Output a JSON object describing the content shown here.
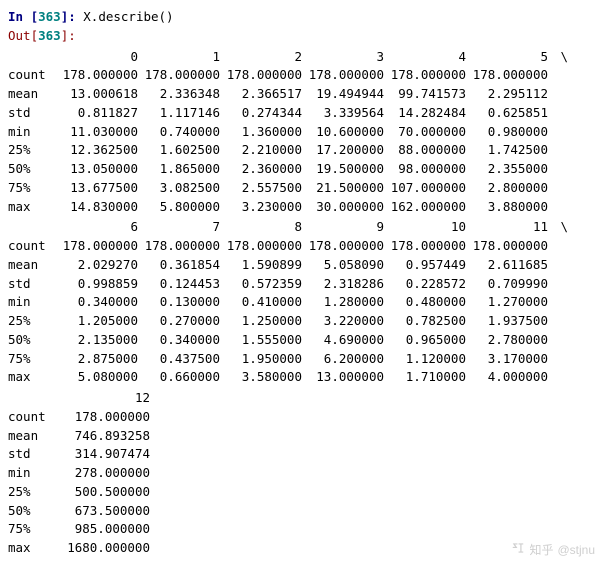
{
  "prompt": {
    "in_label": "In [",
    "in_num": "363",
    "in_close": "]: ",
    "code": "X.describe()",
    "out_label": "Out[",
    "out_num": "363",
    "out_close": "]:"
  },
  "row_labels": [
    "count",
    "mean",
    "std",
    "min",
    "25%",
    "50%",
    "75%",
    "max"
  ],
  "block1": {
    "headers": [
      "0",
      "1",
      "2",
      "3",
      "4",
      "5"
    ],
    "continuation": "\\",
    "rows": [
      [
        "178.000000",
        "178.000000",
        "178.000000",
        "178.000000",
        "178.000000",
        "178.000000"
      ],
      [
        "13.000618",
        "2.336348",
        "2.366517",
        "19.494944",
        "99.741573",
        "2.295112"
      ],
      [
        "0.811827",
        "1.117146",
        "0.274344",
        "3.339564",
        "14.282484",
        "0.625851"
      ],
      [
        "11.030000",
        "0.740000",
        "1.360000",
        "10.600000",
        "70.000000",
        "0.980000"
      ],
      [
        "12.362500",
        "1.602500",
        "2.210000",
        "17.200000",
        "88.000000",
        "1.742500"
      ],
      [
        "13.050000",
        "1.865000",
        "2.360000",
        "19.500000",
        "98.000000",
        "2.355000"
      ],
      [
        "13.677500",
        "3.082500",
        "2.557500",
        "21.500000",
        "107.000000",
        "2.800000"
      ],
      [
        "14.830000",
        "5.800000",
        "3.230000",
        "30.000000",
        "162.000000",
        "3.880000"
      ]
    ]
  },
  "block2": {
    "headers": [
      "6",
      "7",
      "8",
      "9",
      "10",
      "11"
    ],
    "continuation": "\\",
    "rows": [
      [
        "178.000000",
        "178.000000",
        "178.000000",
        "178.000000",
        "178.000000",
        "178.000000"
      ],
      [
        "2.029270",
        "0.361854",
        "1.590899",
        "5.058090",
        "0.957449",
        "2.611685"
      ],
      [
        "0.998859",
        "0.124453",
        "0.572359",
        "2.318286",
        "0.228572",
        "0.709990"
      ],
      [
        "0.340000",
        "0.130000",
        "0.410000",
        "1.280000",
        "0.480000",
        "1.270000"
      ],
      [
        "1.205000",
        "0.270000",
        "1.250000",
        "3.220000",
        "0.782500",
        "1.937500"
      ],
      [
        "2.135000",
        "0.340000",
        "1.555000",
        "4.690000",
        "0.965000",
        "2.780000"
      ],
      [
        "2.875000",
        "0.437500",
        "1.950000",
        "6.200000",
        "1.120000",
        "3.170000"
      ],
      [
        "5.080000",
        "0.660000",
        "3.580000",
        "13.000000",
        "1.710000",
        "4.000000"
      ]
    ]
  },
  "block3": {
    "headers": [
      "12"
    ],
    "rows": [
      [
        "178.000000"
      ],
      [
        "746.893258"
      ],
      [
        "314.907474"
      ],
      [
        "278.000000"
      ],
      [
        "500.500000"
      ],
      [
        "673.500000"
      ],
      [
        "985.000000"
      ],
      [
        "1680.000000"
      ]
    ]
  },
  "watermark": {
    "site": "知乎",
    "handle": "@stjnu"
  }
}
